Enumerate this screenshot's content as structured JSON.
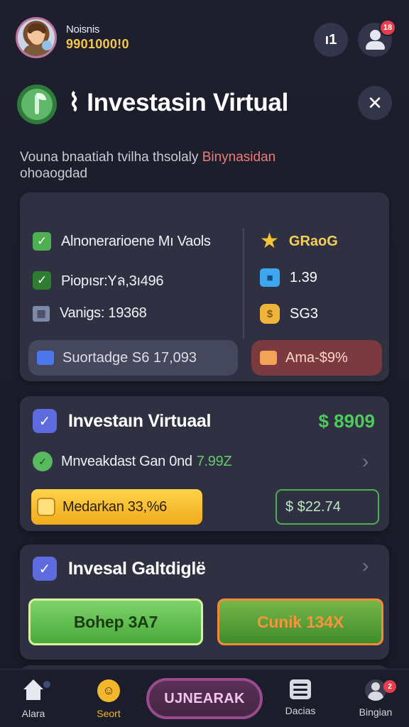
{
  "header": {
    "user_name": "Noisnis",
    "balance": "9901000!0",
    "count_button": "ı1",
    "notification_count": "18"
  },
  "title": {
    "text": "⌇ Investasin Virtual"
  },
  "subtitle": {
    "text": "Vouna bnaatiah tvilha thsolaly",
    "highlight": "Binynasidan",
    "text_line2": "ohoaogdad"
  },
  "stats_card": {
    "rows": [
      {
        "label": "Alnonerarioene Mı Vaols"
      },
      {
        "label": "Piopısr:Yล,3ı496"
      },
      {
        "label": "Vanigs: 19368"
      }
    ],
    "side": [
      {
        "icon": "star-icon",
        "value": "GRaoG"
      },
      {
        "icon": "cube-icon",
        "value": "1.39"
      },
      {
        "icon": "bag-icon",
        "value": "SG3"
      }
    ],
    "pill_left": "Suortadge S6 17,093",
    "pill_right": "Ama-$9%"
  },
  "invest_card": {
    "title": "Investaın Virtuaal",
    "amount": "$ 8909",
    "sub_label": "Mnveakdast Gan 0nd",
    "sub_value": "7.99Z",
    "gold_button": "Medarkan 33,%6",
    "outline_amount": "$ $22.74"
  },
  "gal_card": {
    "title": "Invesal Galtdiglë",
    "button_left": "Bohep 3A7",
    "button_right": "Cunik 134X"
  },
  "bottom_nav": {
    "items": [
      {
        "label": "Alara"
      },
      {
        "label": "Seort"
      },
      {
        "label": "Dacias"
      },
      {
        "label": "Bingian"
      }
    ],
    "center_label": "UJNEARAK",
    "badge": "2"
  },
  "colors": {
    "background": "#1e1f2e",
    "card": "#2f3142",
    "accent_gold": "#f4cf5b",
    "accent_green": "#4ecb5c",
    "badge_red": "#e53e4f"
  }
}
